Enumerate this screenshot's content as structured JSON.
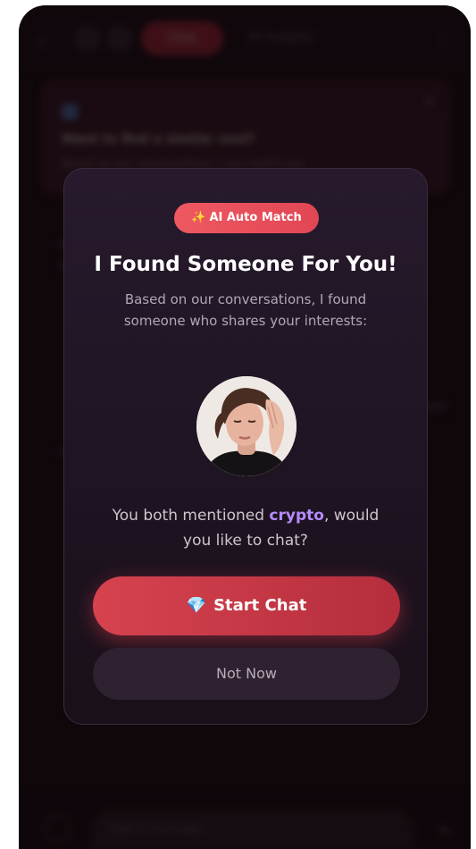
{
  "background_app": {
    "tab_active": "Chat",
    "tab_other": "AI Insights",
    "card_title": "Want to find a similar soul?",
    "card_subtitle": "Based on our conversations, I can match you",
    "input_placeholder": "Type a message..."
  },
  "modal": {
    "badge_label": "AI Auto Match",
    "badge_icon": "sparkles-icon",
    "title": "I Found Someone For You!",
    "subtitle": "Based on our conversations, I found someone who shares your interests:",
    "avatar_alt": "matched-user-avatar",
    "match_prefix": "You both mentioned ",
    "match_keyword": "crypto",
    "match_suffix": ", would you like to chat?",
    "start_button_icon": "gem-icon",
    "start_button_label": "Start Chat",
    "later_button_label": "Not Now"
  },
  "colors": {
    "accent": "#d6434f",
    "badge": "#ee5961",
    "keyword": "#b58cff",
    "modal_bg": "#231826"
  }
}
